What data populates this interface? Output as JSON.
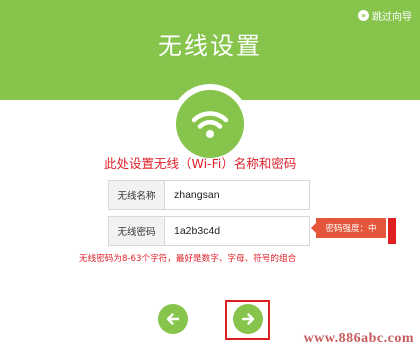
{
  "header": {
    "title": "无线设置",
    "skip_label": "跳过向导",
    "background": "#86c44c"
  },
  "wifi_badge": {
    "icon": "wifi-icon"
  },
  "instruction": "此处设置无线（Wi-Fi）名称和密码",
  "form": {
    "ssid": {
      "label": "无线名称",
      "value": "zhangsan"
    },
    "password": {
      "label": "无线密码",
      "value": "1a2b3c4d",
      "strength_text": "密码强度：中"
    },
    "hint": "无线密码为8-63个字符，最好是数字、字母、符号的组合"
  },
  "nav": {
    "prev_icon": "arrow-left-icon",
    "next_icon": "arrow-right-icon"
  },
  "watermark": "www.886abc.com",
  "colors": {
    "accent": "#86c44c",
    "alert": "#e0202a",
    "strength": "#e4573a"
  }
}
